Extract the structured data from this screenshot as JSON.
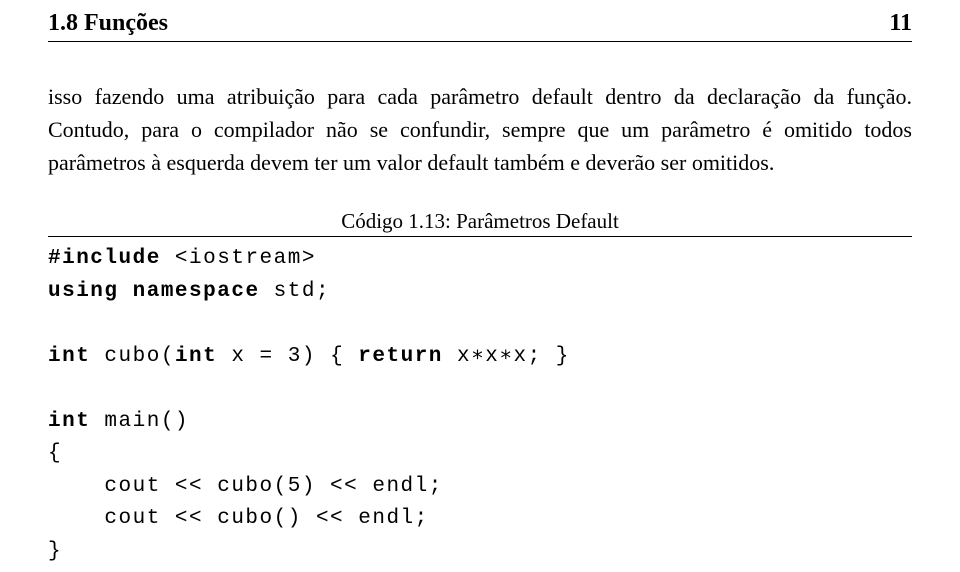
{
  "header": {
    "section": "1.8 Funções",
    "page_number": "11"
  },
  "paragraph": "isso fazendo uma atribuição para cada parâmetro default dentro da declaração da função. Contudo, para o compilador não se confundir, sempre que um parâmetro é omitido todos parâmetros à esquerda devem ter um valor default também e deverão ser omitidos.",
  "code_caption": "Código 1.13: Parâmetros Default",
  "code": {
    "l1a": "#include",
    "l1b": " <iostream>",
    "l2a": "using",
    "l2b": " ",
    "l2c": "namespace",
    "l2d": " std;",
    "blank1": "",
    "l3a": "int",
    "l3b": " cubo(",
    "l3c": "int",
    "l3d": " x = 3) { ",
    "l3e": "return",
    "l3f": " x∗x∗x; }",
    "blank2": "",
    "l4a": "int",
    "l4b": " main()",
    "l5": "{",
    "l6": "    cout << cubo(5) << endl;",
    "l7": "    cout << cubo() << endl;",
    "l8": "}"
  }
}
